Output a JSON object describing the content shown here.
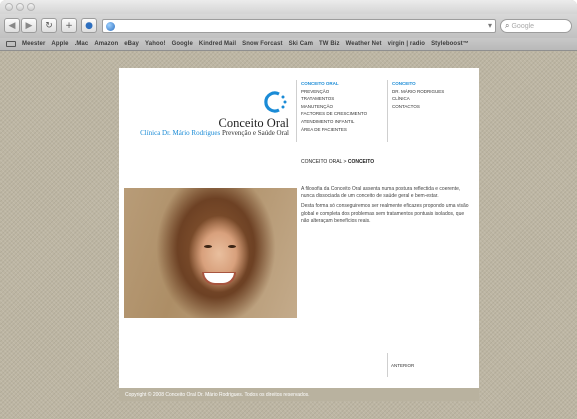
{
  "browser": {
    "search_placeholder": "Google",
    "bookmarks": [
      "Meester",
      "Apple",
      ".Mac",
      "Amazon",
      "eBay",
      "Yahoo!",
      "Google",
      "Kindred Mail",
      "Snow Forcast",
      "Ski Cam",
      "TW Biz",
      "Weather Net",
      "virgin | radio",
      "Styleboost™"
    ]
  },
  "site": {
    "logo_title": "Conceito Oral",
    "logo_sub_clinic": "Clínica Dr. Mário Rodrigues",
    "logo_sub_tagline": " Prevenção e Saúde Oral",
    "menu_main": [
      "Conceito Oral",
      "Prevenção",
      "Tratamentos",
      "Manutenção",
      "Factores de Crescimento",
      "Atendimento Infantil",
      "Área de Pacientes"
    ],
    "menu_secondary": [
      "Conceito",
      "Dr. Mário Rodrigues",
      "Clínica",
      "Contactos"
    ],
    "breadcrumb_parent": "Conceito Oral",
    "breadcrumb_sep": " > ",
    "breadcrumb_current": "Conceito",
    "paragraph_1": "A filosofia da Conceito Oral assenta numa postura reflectida e coerente, nunca dissociada de um conceito de saúde geral e bem-estar.",
    "paragraph_2": "Desta forma só conseguiremos ser realmente eficazes propondo uma visão global e completa dos problemas sem tratamentos pontuais isolados, que não alteraçam benefícios reais.",
    "anterior": "Anterior",
    "footer": "Copyright © 2008 Conceito Oral Dr. Mário Rodrigues. Todos os direitos reservados."
  },
  "colors": {
    "accent": "#1a8bd6",
    "backdrop": "#bdb6a3",
    "footer": "#b9b29f"
  }
}
